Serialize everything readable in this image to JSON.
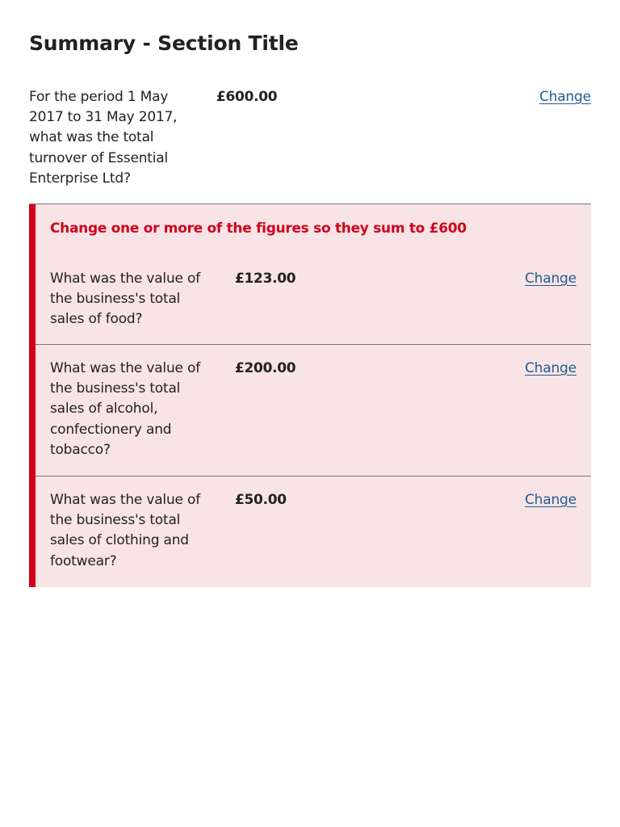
{
  "summary": {
    "title": "Summary - Section Title",
    "total": {
      "question": "For the period 1 May 2017 to 31 May 2017, what was the total turnover of Essential Enterprise Ltd?",
      "value": "£600.00",
      "change_label": "Change"
    },
    "error": {
      "message": "Change one or more of the figures so they sum to £600",
      "color": "#d0021b",
      "background": "#f8e3e6"
    },
    "items": [
      {
        "question": "What was the value of the business's total sales of food?",
        "value": "£123.00",
        "change_label": "Change"
      },
      {
        "question": "What was the value of the business's total sales of alcohol, confectionery and tobacco?",
        "value": "£200.00",
        "change_label": "Change"
      },
      {
        "question": "What was the value of the business's total sales of clothing and footwear?",
        "value": "£50.00",
        "change_label": "Change"
      }
    ],
    "link_color": "#1f5c8e"
  }
}
